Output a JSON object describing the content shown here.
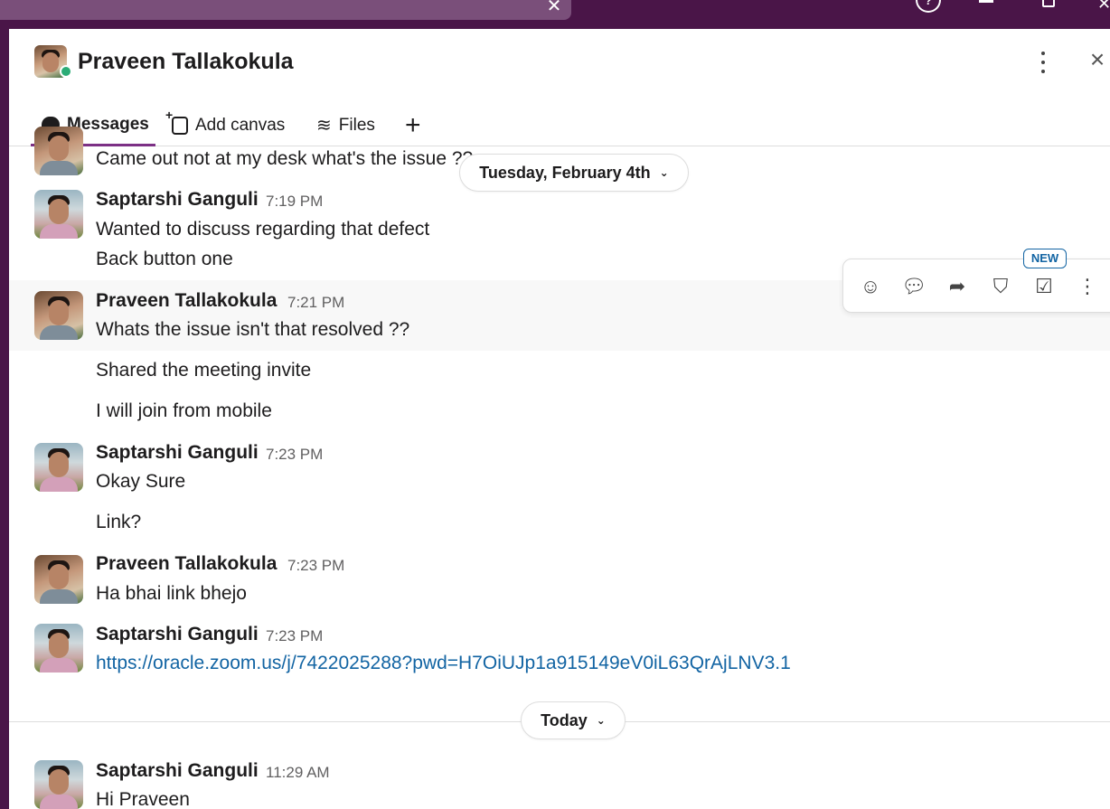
{
  "window": {
    "close_glyph": "✕",
    "help_glyph": "?"
  },
  "header": {
    "title": "Praveen Tallakokula",
    "presence": "active"
  },
  "tabs": [
    {
      "label": "Messages",
      "icon": "message-bubble-icon",
      "active": true
    },
    {
      "label": "Add canvas",
      "icon": "canvas-icon"
    },
    {
      "label": "Files",
      "icon": "layers-icon"
    },
    {
      "label": "+",
      "icon": "plus-icon"
    }
  ],
  "date_divider_1": "Tuesday, February 4th",
  "date_divider_2": "Today",
  "messages": [
    {
      "text": "Came out not at my desk what's the issue ??"
    },
    {
      "sender": "Saptarshi Ganguli",
      "time": "7:19 PM",
      "lines": [
        "Wanted to discuss regarding that defect",
        "Back button one"
      ]
    },
    {
      "sender": "Praveen Tallakokula",
      "time": "7:21 PM",
      "lines": [
        "Whats the issue isn't that resolved ??"
      ]
    },
    {
      "text": "Shared the meeting invite"
    },
    {
      "text": "I will join from mobile"
    },
    {
      "sender": "Saptarshi Ganguli",
      "time": "7:23 PM",
      "lines": [
        "Okay Sure"
      ]
    },
    {
      "text": "Link?"
    },
    {
      "sender": "Praveen Tallakokula",
      "time": "7:23 PM",
      "lines": [
        "Ha bhai link bhejo"
      ]
    },
    {
      "sender": "Saptarshi Ganguli",
      "time": "7:23 PM",
      "link": "https://oracle.zoom.us/j/7422025288?pwd=H7OiUJp1a915149eV0iL63QrAjLNV3.1"
    },
    {
      "sender": "Saptarshi Ganguli",
      "time": "11:29 AM",
      "lines": [
        "Hi Praveen"
      ]
    }
  ],
  "toolbar": {
    "new_badge": "NEW",
    "actions": [
      "add-reaction-icon",
      "reply-thread-icon",
      "forward-icon",
      "save-bookmark-icon",
      "add-to-list-icon",
      "more-actions-icon"
    ]
  },
  "colors": {
    "brand": "#4a1548",
    "accent_tab": "#7c3085",
    "link": "#1264a3",
    "presence": "#2bac76"
  }
}
